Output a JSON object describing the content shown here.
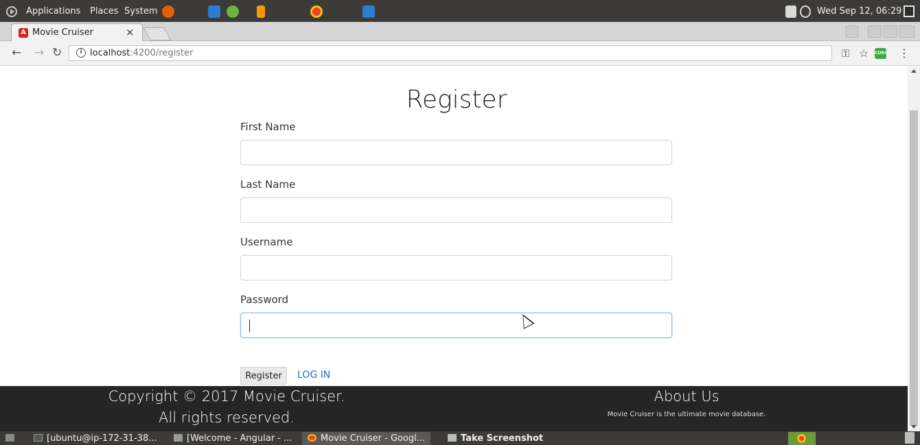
{
  "top_panel": {
    "menus": [
      "Applications",
      "Places",
      "System"
    ],
    "clock": "Wed Sep 12, 06:29",
    "colors": {
      "firefox": "#e66000",
      "vscode": "#2b7cd3",
      "spring": "#6db33f",
      "sublime": "#ff9800",
      "chrome": "#1a73e8"
    }
  },
  "browser": {
    "tab_title": "Movie Cruiser",
    "tab_close": "×",
    "url_host": "localhost",
    "url_rest": ":4200/register",
    "icons": [
      "back-arrow-icon",
      "forward-arrow-icon",
      "reload-icon",
      "info-icon",
      "key-icon",
      "star-icon",
      "cors-extension-icon",
      "menu-icon"
    ]
  },
  "page": {
    "title": "Register",
    "fields": [
      {
        "label": "First Name",
        "value": ""
      },
      {
        "label": "Last Name",
        "value": ""
      },
      {
        "label": "Username",
        "value": ""
      },
      {
        "label": "Password",
        "value": ""
      }
    ],
    "register_button": "Register",
    "login_link": "LOG IN",
    "link_color": "#1a73c8"
  },
  "footer": {
    "copyright_line1": "Copyright © 2017 Movie Cruiser.",
    "copyright_line2": "All rights reserved.",
    "about_title": "About Us",
    "about_text": "Movie Cruiser is the ultimate movie database.",
    "background": "#252525"
  },
  "taskbar": {
    "items": [
      {
        "label": "[ubuntu@ip-172-31-38...",
        "icon": "terminal-icon"
      },
      {
        "label": "[Welcome - Angular - ...",
        "icon": "window-icon"
      },
      {
        "label": "Movie Cruiser - Googl...",
        "icon": "chrome-icon"
      },
      {
        "label": "Take Screenshot",
        "icon": "screenshot-icon"
      }
    ]
  }
}
